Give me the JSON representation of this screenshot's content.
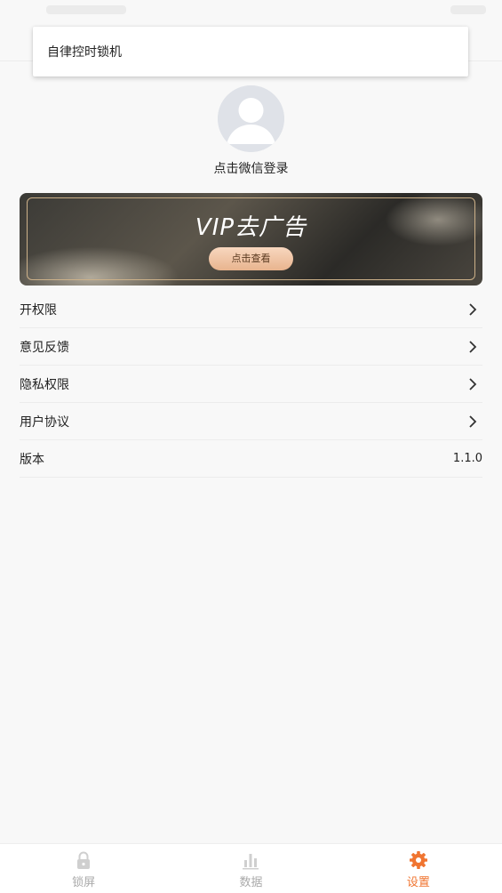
{
  "popup": {
    "title": "自律控时锁机"
  },
  "profile": {
    "login_text": "点击微信登录"
  },
  "vip_banner": {
    "title": "VIP去广告",
    "button_label": "点击查看"
  },
  "menu": {
    "items": [
      {
        "label": "开权限",
        "value": ""
      },
      {
        "label": "意见反馈",
        "value": ""
      },
      {
        "label": "隐私权限",
        "value": ""
      },
      {
        "label": "用户协议",
        "value": ""
      },
      {
        "label": "版本",
        "value": "1.1.0"
      }
    ]
  },
  "bottom_nav": {
    "items": [
      {
        "label": "锁屏",
        "icon": "lock-icon",
        "active": false
      },
      {
        "label": "数据",
        "icon": "bar-chart-icon",
        "active": false
      },
      {
        "label": "设置",
        "icon": "gear-icon",
        "active": true
      }
    ]
  },
  "colors": {
    "accent": "#f07531",
    "inactive": "#aaaaaa",
    "background": "#f8f8f8"
  }
}
